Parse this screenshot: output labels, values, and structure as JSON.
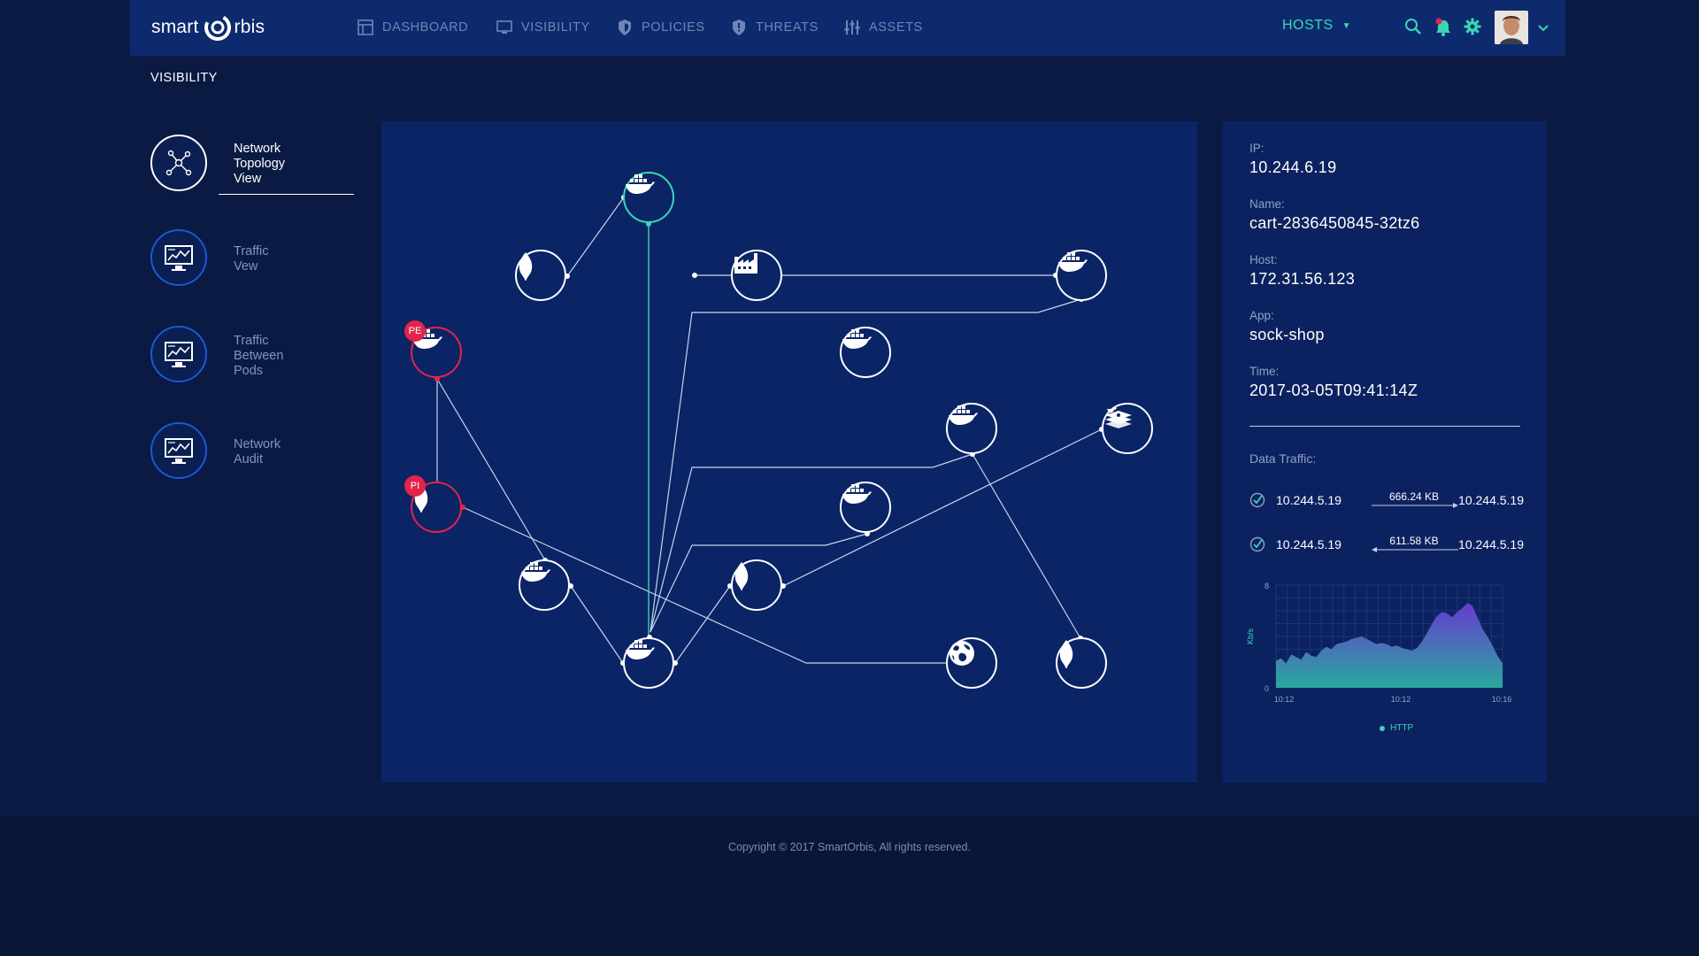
{
  "brand": {
    "name_left": "smart",
    "name_right": "rbis"
  },
  "nav": {
    "items": [
      {
        "label": "DASHBOARD",
        "icon": "dashboard-icon"
      },
      {
        "label": "VISIBILITY",
        "icon": "monitor-icon"
      },
      {
        "label": "POLICIES",
        "icon": "shield-icon"
      },
      {
        "label": "THREATS",
        "icon": "shield-alert-icon"
      },
      {
        "label": "ASSETS",
        "icon": "sliders-icon"
      }
    ],
    "hosts_label": "HOSTS"
  },
  "page_title": "VISIBILITY",
  "sidebar": {
    "items": [
      {
        "label_lines": [
          "Network",
          "Topology",
          "View"
        ],
        "active": true
      },
      {
        "label_lines": [
          "Traffic",
          "Vew"
        ],
        "active": false
      },
      {
        "label_lines": [
          "Traffic",
          "Between",
          "Pods"
        ],
        "active": false
      },
      {
        "label_lines": [
          "Network",
          "Audit"
        ],
        "active": false
      }
    ]
  },
  "topology": {
    "badges": {
      "pe": "PE",
      "pi": "PI"
    }
  },
  "details": {
    "ip_label": "IP:",
    "ip": "10.244.6.19",
    "name_label": "Name:",
    "name": "cart-2836450845-32tz6",
    "host_label": "Host:",
    "host": "172.31.56.123",
    "app_label": "App:",
    "app": "sock-shop",
    "time_label": "Time:",
    "time": "2017-03-05T09:41:14Z",
    "traffic_title": "Data Traffic:",
    "traffic": [
      {
        "src": "10.244.5.19",
        "size": "666.24 KB",
        "dst": "10.244.5.19",
        "direction": "right"
      },
      {
        "src": "10.244.5.19",
        "size": "611.58 KB",
        "dst": "10.244.5.19",
        "direction": "left"
      }
    ]
  },
  "chart_data": {
    "type": "area",
    "ylabel": "Kb/s",
    "ylim": [
      0,
      8
    ],
    "yticks": [
      "0",
      "8"
    ],
    "xticks": [
      "10:12",
      "10:12",
      "10:16"
    ],
    "series": [
      {
        "name": "HTTP",
        "values": [
          2.1,
          2.3,
          1.9,
          2.6,
          2.4,
          2.2,
          2.8,
          2.5,
          2.4,
          2.9,
          3.2,
          3.0,
          3.4,
          3.5,
          3.6,
          3.8,
          3.9,
          4.0,
          3.8,
          3.6,
          3.4,
          3.5,
          3.4,
          3.2,
          3.3,
          3.1,
          3.0,
          2.9,
          3.1,
          3.6,
          4.3,
          5.0,
          5.6,
          5.9,
          5.8,
          5.5,
          5.9,
          6.2,
          6.6,
          6.4,
          5.5,
          4.6,
          4.0,
          3.3,
          2.5,
          1.9
        ]
      }
    ],
    "colors": {
      "top": "#6a3cd6",
      "bottom": "#2bb0a0"
    }
  },
  "footer": {
    "copyright": "Copyright © 2017 SmartOrbis, All rights reserved."
  }
}
